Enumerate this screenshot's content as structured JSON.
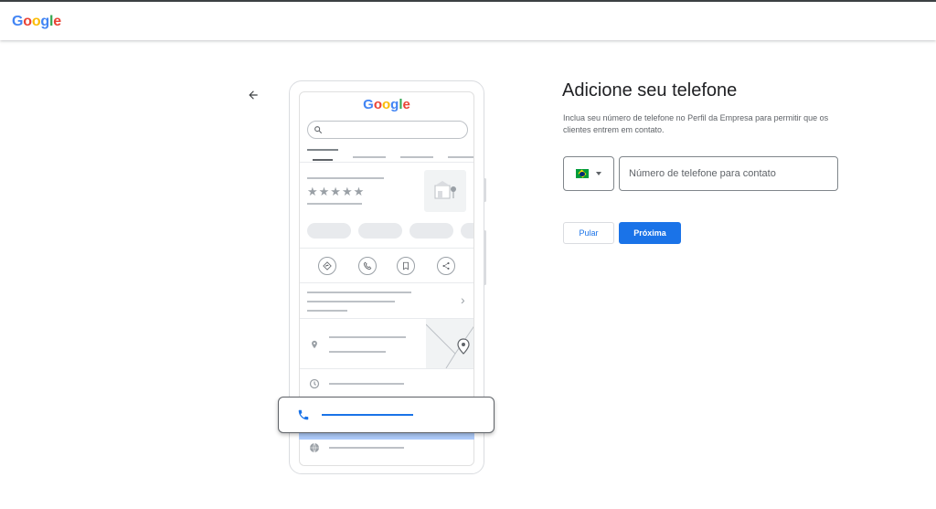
{
  "header": {
    "logo_letters": [
      {
        "char": "G",
        "color": "#4285F4"
      },
      {
        "char": "o",
        "color": "#EA4335"
      },
      {
        "char": "o",
        "color": "#FBBC05"
      },
      {
        "char": "g",
        "color": "#4285F4"
      },
      {
        "char": "l",
        "color": "#34A853"
      },
      {
        "char": "e",
        "color": "#EA4335"
      }
    ]
  },
  "back_icon": "arrow-left-icon",
  "illustration": {
    "logo": "Google",
    "stars": "★★★★★",
    "chevron": "›"
  },
  "form": {
    "title": "Adicione seu telefone",
    "description": "Inclua seu número de telefone no Perfil da Empresa para permitir que os clientes entrem em contato.",
    "country_flag": "brazil-flag-icon",
    "phone_placeholder": "Número de telefone para contato",
    "phone_value": "",
    "skip_label": "Pular",
    "next_label": "Próxima"
  },
  "colors": {
    "accent": "#1a73e8",
    "highlight_band": "#aecbfa"
  }
}
